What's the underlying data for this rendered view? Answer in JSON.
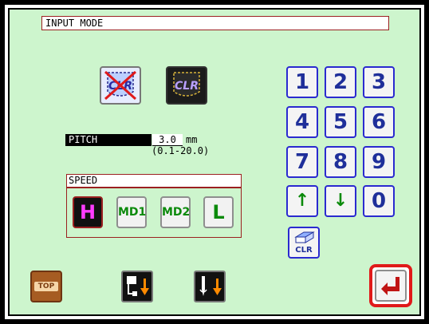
{
  "header": {
    "mode_title": "INPUT MODE"
  },
  "pocket_buttons": [
    {
      "label": "CLR",
      "state": "disabled",
      "icon": "pocket-clr-crossed-icon"
    },
    {
      "label": "CLR",
      "state": "active",
      "icon": "pocket-clr-icon"
    }
  ],
  "pitch": {
    "label": "PITCH",
    "value": "3.0",
    "unit": "mm",
    "range": "(0.1-20.0)"
  },
  "speed": {
    "title": "SPEED",
    "options": [
      "H",
      "MD1",
      "MD2",
      "L"
    ],
    "selected": "H"
  },
  "keypad": {
    "keys": [
      "1",
      "2",
      "3",
      "4",
      "5",
      "6",
      "7",
      "8",
      "9",
      "↑",
      "↓",
      "0"
    ],
    "clear_label": "CLR"
  },
  "footer": {
    "top_label": "TOP",
    "enter_icon": "enter-return-icon"
  },
  "colors": {
    "screen_bg": "#cdf5cd",
    "accent_red": "#e01a1a",
    "keypad_blue": "#2a2ad0",
    "speed_green": "#0c8a0c",
    "selected_magenta": "#ff3cff"
  }
}
